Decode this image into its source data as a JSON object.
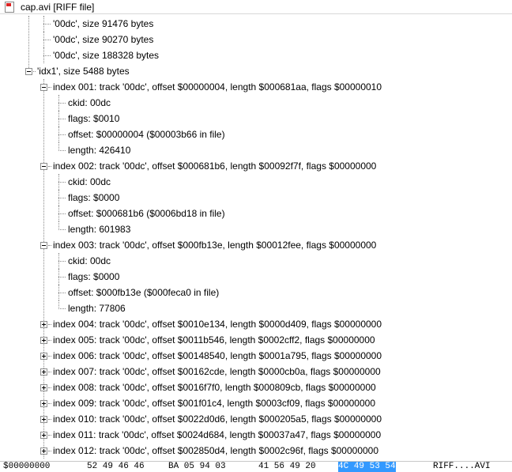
{
  "window": {
    "title": "cap.avi [RIFF file]",
    "icon": "document-icon"
  },
  "tree": {
    "rows": [
      {
        "text": "'00dc', size 91476 bytes",
        "level": 2
      },
      {
        "text": "'00dc', size 90270 bytes",
        "level": 2
      },
      {
        "text": "'00dc', size 188328 bytes",
        "level": 2
      },
      {
        "text": "'idx1', size 5488 bytes",
        "level": 1,
        "expander": "minus"
      },
      {
        "text": "index 001: track '00dc', offset $00000004, length $000681aa, flags $00000010",
        "level": 2,
        "expander": "minus"
      },
      {
        "text": "ckid: 00dc",
        "level": 3
      },
      {
        "text": "flags: $0010",
        "level": 3
      },
      {
        "text": "offset: $00000004 ($00003b66 in file)",
        "level": 3
      },
      {
        "text": "length: 426410",
        "level": 3
      },
      {
        "text": "index 002: track '00dc', offset $000681b6, length $00092f7f, flags $00000000",
        "level": 2,
        "expander": "minus"
      },
      {
        "text": "ckid: 00dc",
        "level": 3
      },
      {
        "text": "flags: $0000",
        "level": 3
      },
      {
        "text": "offset: $000681b6 ($0006bd18 in file)",
        "level": 3
      },
      {
        "text": "length: 601983",
        "level": 3
      },
      {
        "text": "index 003: track '00dc', offset $000fb13e, length $00012fee, flags $00000000",
        "level": 2,
        "expander": "minus"
      },
      {
        "text": "ckid: 00dc",
        "level": 3
      },
      {
        "text": "flags: $0000",
        "level": 3
      },
      {
        "text": "offset: $000fb13e ($000feca0 in file)",
        "level": 3
      },
      {
        "text": "length: 77806",
        "level": 3
      },
      {
        "text": "index 004: track '00dc', offset $0010e134, length $0000d409, flags $00000000",
        "level": 2,
        "expander": "plus"
      },
      {
        "text": "index 005: track '00dc', offset $0011b546, length $0002cff2, flags $00000000",
        "level": 2,
        "expander": "plus"
      },
      {
        "text": "index 006: track '00dc', offset $00148540, length $0001a795, flags $00000000",
        "level": 2,
        "expander": "plus"
      },
      {
        "text": "index 007: track '00dc', offset $00162cde, length $0000cb0a, flags $00000000",
        "level": 2,
        "expander": "plus"
      },
      {
        "text": "index 008: track '00dc', offset $0016f7f0, length $000809cb, flags $00000000",
        "level": 2,
        "expander": "plus"
      },
      {
        "text": "index 009: track '00dc', offset $001f01c4, length $0003cf09, flags $00000000",
        "level": 2,
        "expander": "plus"
      },
      {
        "text": "index 010: track '00dc', offset $0022d0d6, length $000205a5, flags $00000000",
        "level": 2,
        "expander": "plus"
      },
      {
        "text": "index 011: track '00dc', offset $0024d684, length $00037a47, flags $00000000",
        "level": 2,
        "expander": "plus"
      },
      {
        "text": "index 012: track '00dc', offset $002850d4, length $0002c96f, flags $00000000",
        "level": 2,
        "expander": "plus"
      }
    ]
  },
  "hex": {
    "address": "$00000000",
    "group1": "52 49 46 46",
    "group2": "BA 05 94 03",
    "group3": "41 56 49 20",
    "group4_selected": "4C 49 53 54",
    "ascii": "RIFF....AVI"
  },
  "colors": {
    "selection": "#3399ff",
    "tree_lines": "#8a8a8a"
  }
}
